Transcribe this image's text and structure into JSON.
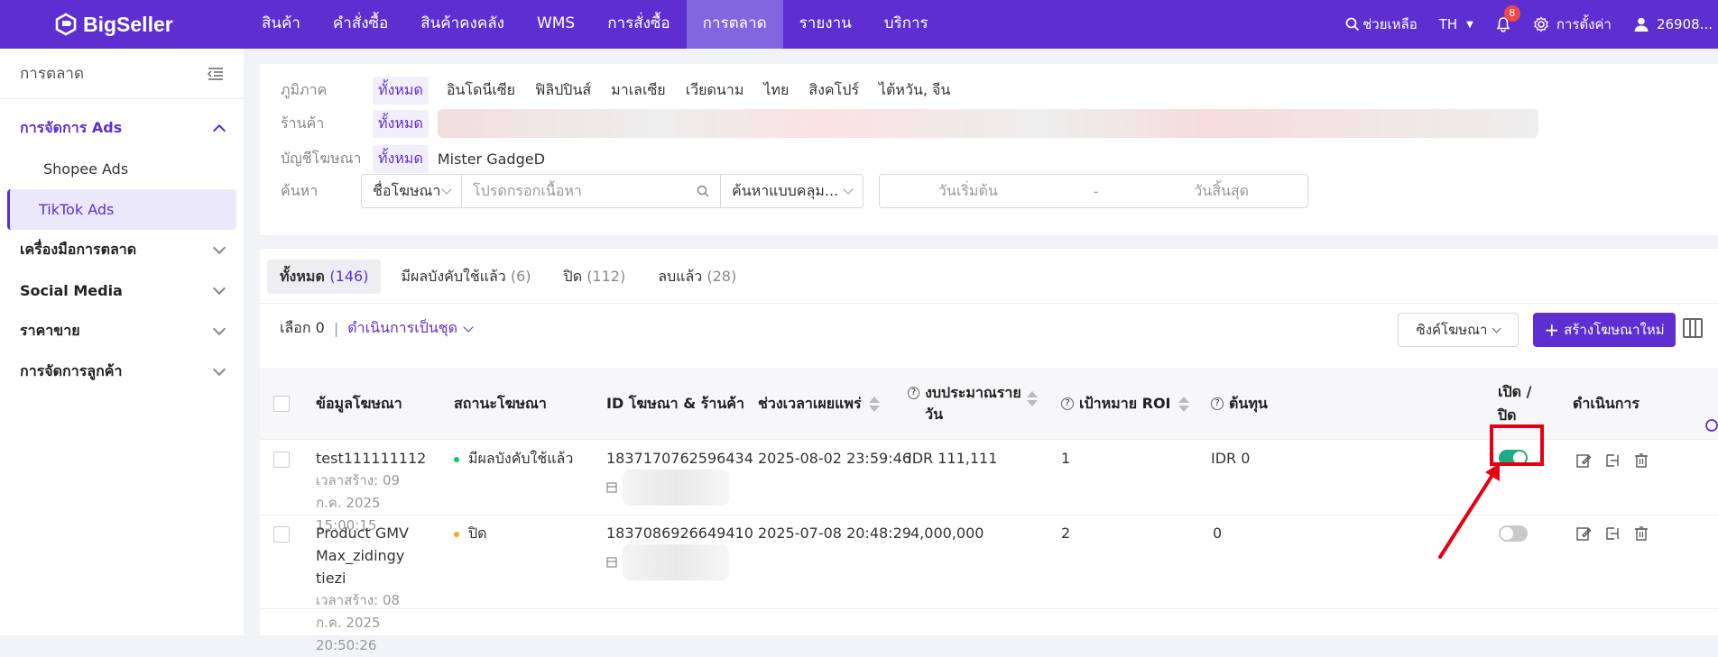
{
  "topbar": {
    "logo": "BigSeller",
    "nav": [
      "สินค้า",
      "คำสั่งซื้อ",
      "สินค้าคงคลัง",
      "WMS",
      "การสั่งซื้อ",
      "การตลาด",
      "รายงาน",
      "บริการ"
    ],
    "help": "ช่วยเหลือ",
    "lang": "TH",
    "notifications": "8",
    "settings": "การตั้งค่า",
    "user": "26908..."
  },
  "sidebar": {
    "title": "การตลาด",
    "sections": [
      {
        "label": "การจัดการ Ads",
        "children": [
          "Shopee Ads",
          "TikTok Ads"
        ]
      },
      {
        "label": "เครื่องมือการตลาด"
      },
      {
        "label": "Social Media"
      },
      {
        "label": "ราคาขาย"
      },
      {
        "label": "การจัดการลูกค้า"
      }
    ]
  },
  "filters": {
    "region_label": "ภูมิภาค",
    "region_all": "ทั้งหมด",
    "regions": [
      "อินโดนีเซีย",
      "ฟิลิปปินส์",
      "มาเลเซีย",
      "เวียดนาม",
      "ไทย",
      "สิงคโปร์",
      "ไต้หวัน, จีน"
    ],
    "store_label": "ร้านค้า",
    "store_all": "ทั้งหมด",
    "account_label": "บัญชีโฆษณา",
    "account_all": "ทั้งหมด",
    "account_name": "Mister GadgeD",
    "search_label": "ค้นหา",
    "search_field": "ชื่อโฆษณา",
    "search_placeholder": "โปรดกรอกเนื้อหา",
    "search_mode": "ค้นหาแบบคลุม...",
    "date_start": "วันเริ่มต้น",
    "date_sep": "-",
    "date_end": "วันสิ้นสุด"
  },
  "tabs": [
    {
      "label": "ทั้งหมด",
      "count": "(146)"
    },
    {
      "label": "มีผลบังคับใช้แล้ว",
      "count": "(6)"
    },
    {
      "label": "ปิด",
      "count": "(112)"
    },
    {
      "label": "ลบแล้ว",
      "count": "(28)"
    }
  ],
  "toolbar": {
    "selected": "เลือก 0",
    "sep": "|",
    "batch": "ดำเนินการเป็นชุด",
    "sync": "ซิงค์โฆษณา",
    "create": "สร้างโฆษณาใหม่"
  },
  "columns": {
    "info": "ข้อมูลโฆษณา",
    "status": "สถานะโฆษณา",
    "id": "ID โฆษณา & ร้านค้า",
    "period": "ช่วงเวลาเผยแพร่",
    "budget": "งบประมาณรายวัน",
    "roi": "เป้าหมาย ROI",
    "cost": "ต้นทุน",
    "toggle": "เปิด / ปิด",
    "actions": "ดำเนินการ"
  },
  "rows": [
    {
      "name": "test111111112",
      "created": "เวลาสร้าง: 09 ก.ค. 2025 15:00:15",
      "status": "มีผลบังคับใช้แล้ว",
      "status_color": "#1dbf73",
      "ad_id": "1837170762596434",
      "period": "2025-08-02 23:59:46",
      "budget": "IDR 111,111",
      "roi": "1",
      "cost": "IDR 0",
      "enabled": true
    },
    {
      "name": "Product GMV Max_zidingy tiezi",
      "created": "เวลาสร้าง: 08 ก.ค. 2025 20:50:26",
      "status": "ปิด",
      "status_color": "#f5a623",
      "ad_id": "1837086926649410",
      "period": "2025-07-08 20:48:29",
      "budget": "4,000,000",
      "roi": "2",
      "cost": "0",
      "enabled": false
    }
  ],
  "colors": {
    "brand": "#5e2fd0",
    "on": "#1dab84",
    "off": "#c9c9c9",
    "annotation": "#e60012"
  }
}
